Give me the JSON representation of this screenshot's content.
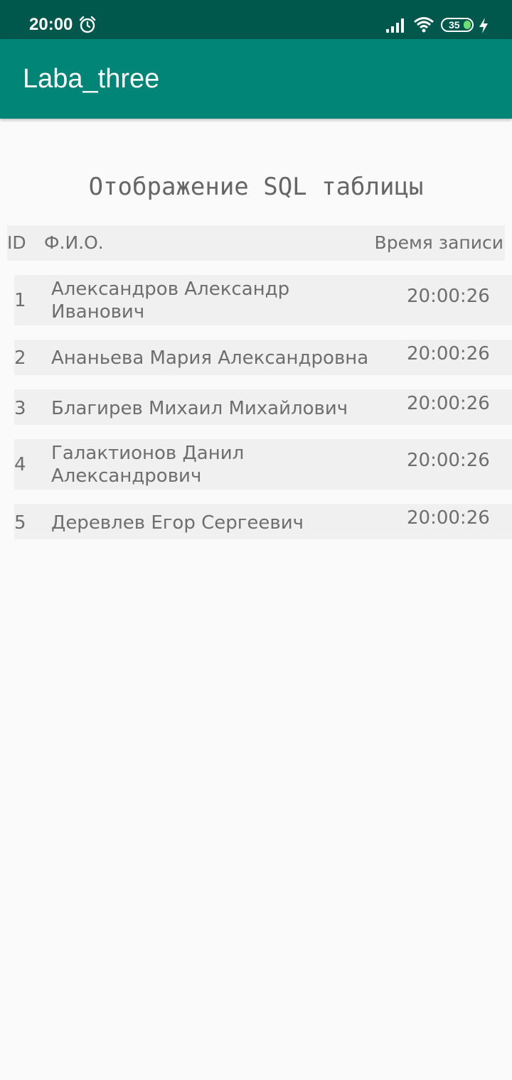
{
  "status_bar": {
    "time": "20:00",
    "battery_level": "35",
    "icons": [
      "alarm-icon",
      "signal-icon",
      "wifi-icon",
      "battery-icon",
      "charging-icon"
    ],
    "colors": {
      "background": "#00574b",
      "battery_fill": "#6fe06f"
    }
  },
  "app_bar": {
    "title": "Laba_three",
    "color": "#008577"
  },
  "main": {
    "heading": "Отображение SQL таблицы",
    "table": {
      "headers": {
        "id": "ID",
        "name": "Ф.И.О.",
        "time": "Время записи"
      },
      "rows": [
        {
          "id": "1",
          "name": "Александров Александр Иванович",
          "time": "20:00:26"
        },
        {
          "id": "2",
          "name": "Ананьева Мария Александровна",
          "time": "20:00:26"
        },
        {
          "id": "3",
          "name": "Благирев Михаил Михайлович",
          "time": "20:00:26"
        },
        {
          "id": "4",
          "name": "Галактионов Данил Александрович",
          "time": "20:00:26"
        },
        {
          "id": "5",
          "name": "Деревлев Егор Сергеевич",
          "time": "20:00:26"
        }
      ]
    }
  }
}
